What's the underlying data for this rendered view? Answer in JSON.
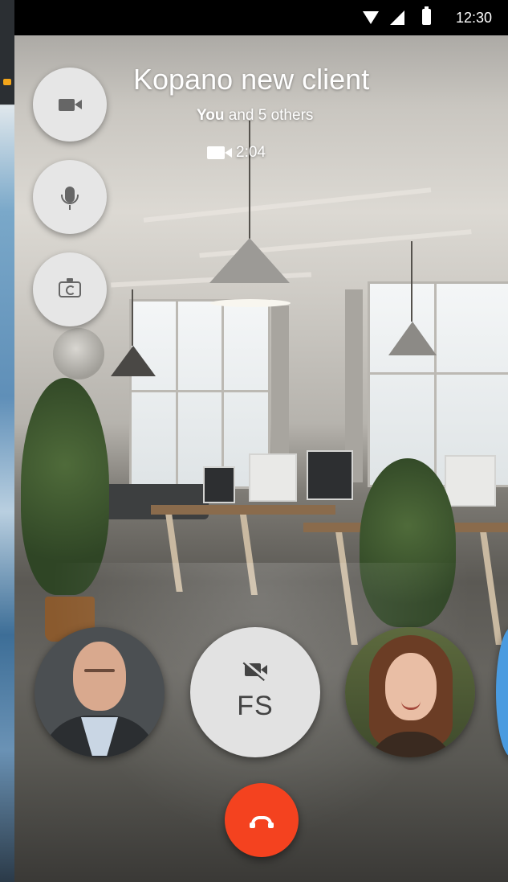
{
  "status_bar": {
    "time": "12:30",
    "icons": [
      "wifi-icon",
      "signal-icon",
      "battery-icon"
    ]
  },
  "call": {
    "title": "Kopano new client",
    "participants_you": "You",
    "participants_rest": " and 5 others",
    "duration": "2:04"
  },
  "controls": [
    {
      "name": "video-toggle-button",
      "icon": "video-camera-icon"
    },
    {
      "name": "mute-button",
      "icon": "microphone-icon"
    },
    {
      "name": "switch-camera-button",
      "icon": "switch-camera-icon"
    }
  ],
  "participants_row": [
    {
      "type": "photo",
      "description": "man"
    },
    {
      "type": "initials",
      "initials": "FS",
      "icon": "video-off-icon"
    },
    {
      "type": "photo",
      "description": "woman"
    },
    {
      "type": "photo-partial"
    }
  ],
  "hangup": {
    "icon": "hangup-icon"
  },
  "colors": {
    "hangup": "#f4421f",
    "control_bg": "#e6e6e6",
    "statusbar_bg": "#000000"
  }
}
